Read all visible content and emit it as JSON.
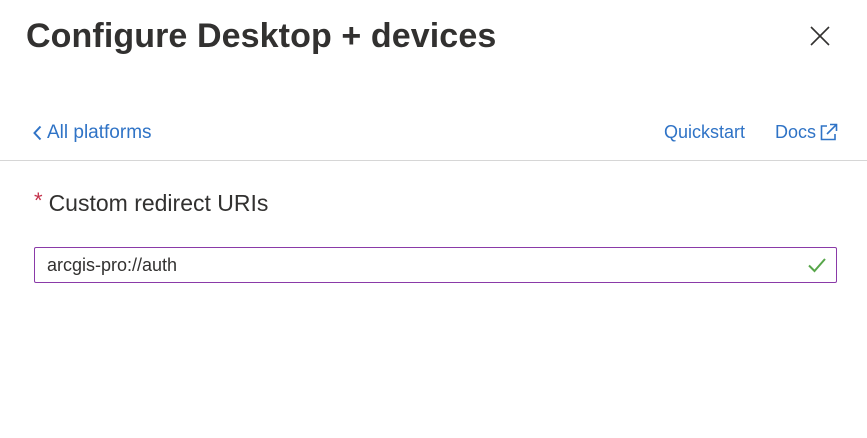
{
  "header": {
    "title": "Configure Desktop + devices",
    "close_icon": "close-icon"
  },
  "nav": {
    "back_label": "All platforms",
    "back_icon": "chevron-left-icon",
    "quickstart_label": "Quickstart",
    "docs_label": "Docs",
    "docs_icon": "external-link-icon"
  },
  "form": {
    "required_marker": "*",
    "redirect_label": "Custom redirect URIs",
    "redirect_value": "arcgis-pro://auth",
    "valid_icon": "checkmark-icon"
  },
  "colors": {
    "link": "#2f73c6",
    "required": "#c4314b",
    "input_focus_border": "#8a3aa8",
    "valid_check": "#57a64a",
    "divider": "#d6d6d6",
    "text": "#323130"
  }
}
